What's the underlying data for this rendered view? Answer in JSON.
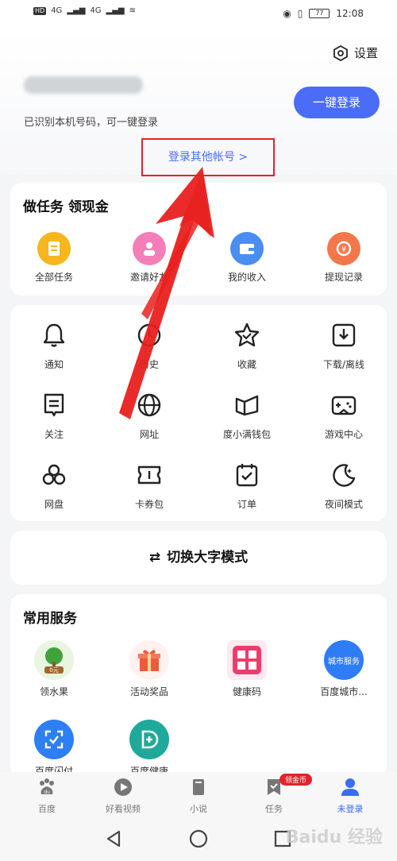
{
  "status_bar": {
    "left_badges": [
      "HD",
      "HD"
    ],
    "network": [
      "4G",
      "4G"
    ],
    "battery": "77",
    "time": "12:08"
  },
  "header": {
    "settings_label": "设置",
    "recognized_text": "已识别本机号码，可一键登录",
    "one_click_login": "一键登录",
    "other_account": "登录其他帐号 >"
  },
  "tasks_card": {
    "title": "做任务 领现金",
    "items": [
      {
        "label": "全部任务",
        "icon": "task-list-icon"
      },
      {
        "label": "邀请好友",
        "icon": "user-icon"
      },
      {
        "label": "我的收入",
        "icon": "wallet-icon"
      },
      {
        "label": "提现记录",
        "icon": "coin-icon"
      }
    ]
  },
  "tools_card": {
    "items": [
      {
        "label": "通知",
        "icon": "bell-icon"
      },
      {
        "label": "历史",
        "icon": "clock-icon"
      },
      {
        "label": "收藏",
        "icon": "star-icon"
      },
      {
        "label": "下载/离线",
        "icon": "download-icon"
      },
      {
        "label": "关注",
        "icon": "bookmark-icon"
      },
      {
        "label": "网址",
        "icon": "globe-icon"
      },
      {
        "label": "度小满钱包",
        "icon": "wallet-book-icon"
      },
      {
        "label": "游戏中心",
        "icon": "gamepad-icon"
      },
      {
        "label": "网盘",
        "icon": "cloud-icon"
      },
      {
        "label": "卡券包",
        "icon": "ticket-icon"
      },
      {
        "label": "订单",
        "icon": "order-icon"
      },
      {
        "label": "夜间模式",
        "icon": "moon-icon"
      }
    ]
  },
  "large_text_mode": "切换大字模式",
  "services_card": {
    "title": "常用服务",
    "items": [
      {
        "label": "领水果",
        "icon": "tree-icon",
        "sub": "0元"
      },
      {
        "label": "活动奖品",
        "icon": "gift-icon"
      },
      {
        "label": "健康码",
        "icon": "health-code-icon"
      },
      {
        "label": "百度城市...",
        "icon": "city-service-icon",
        "sub": "城市服务"
      },
      {
        "label": "百度闪付",
        "icon": "scan-pay-icon"
      },
      {
        "label": "百度健康",
        "icon": "health-icon"
      }
    ]
  },
  "bottom_nav": {
    "items": [
      {
        "label": "百度",
        "icon": "baidu-paw-icon"
      },
      {
        "label": "好看视频",
        "icon": "play-icon"
      },
      {
        "label": "小说",
        "icon": "book-icon"
      },
      {
        "label": "任务",
        "icon": "task-bookmark-icon"
      },
      {
        "label": "未登录",
        "icon": "person-icon"
      }
    ],
    "badge": "领金币"
  },
  "system_nav": {
    "back": "back-icon",
    "home": "home-icon",
    "recent": "recent-icon"
  },
  "watermark": "Baidu 经验",
  "colors": {
    "accent": "#4a6cf7",
    "highlight_box": "#e0242b",
    "arrow": "#e0242b"
  }
}
